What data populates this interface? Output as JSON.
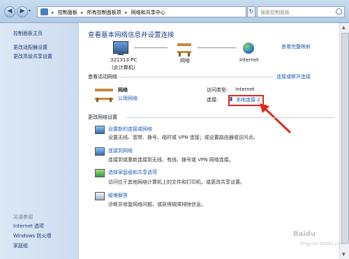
{
  "titlebar": {
    "breadcrumbs": [
      "控制面板",
      "所有控制面板项",
      "网络和共享中心"
    ],
    "search_placeholder": "搜索控制面板"
  },
  "sidebar": {
    "links": [
      "控制面板主页",
      "更改适配器设置",
      "更改高级共享设置"
    ],
    "see_also_label": "另请参阅",
    "see_also_links": [
      "Internet 选项",
      "Windows 防火墙",
      "家庭组"
    ]
  },
  "main": {
    "title": "查看基本网络信息并设置连接",
    "full_map_link": "查看完整映射",
    "map": {
      "computer_name": "321313-PC",
      "computer_sub": "(此计算机)",
      "network": "网络",
      "internet": "Internet"
    },
    "active_section": "查看活动网络",
    "connect_disconnect_link": "连接或断开连接",
    "network_name": "网络",
    "network_type": "公用网络",
    "access_type_label": "访问类型:",
    "access_type_value": "Internet",
    "connection_label": "连接:",
    "connection_value": "本地连接 2",
    "change_section": "更改网络设置",
    "tasks": [
      {
        "title": "设置新的连接或网络",
        "desc": "设置无线、宽带、拨号、临时或 VPN 连接；或设置路由器或访问点。"
      },
      {
        "title": "连接到网络",
        "desc": "连接到或重新连接到无线、有线、拨号或 VPN 网络连接。"
      },
      {
        "title": "选择家庭组和共享选项",
        "desc": "访问位于其他网络计算机上的文件和打印机，或更改共享设置。"
      },
      {
        "title": "疑难解答",
        "desc": "诊断并修复网络问题，或获得故障排除信息。"
      }
    ]
  },
  "watermark": {
    "brand": "Baidu",
    "domain": "jingyan.baidu.com"
  }
}
